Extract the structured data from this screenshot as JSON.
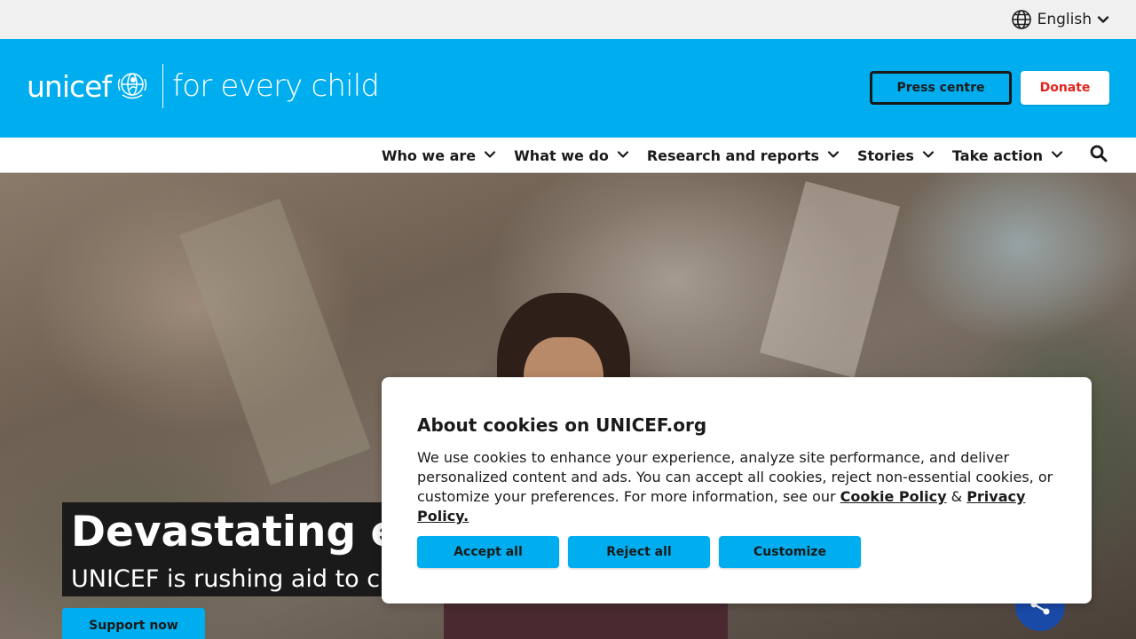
{
  "topbar": {
    "language": "English",
    "language_icon": "globe-icon",
    "language_chevron": "chevron-down-icon"
  },
  "brand": {
    "logo_word": "unicef",
    "tagline": "for every child",
    "press_centre_label": "Press centre",
    "donate_label": "Donate",
    "colors": {
      "brand_blue": "#00aeef",
      "donate_red": "#e2231a",
      "dark": "#1a1a1a"
    }
  },
  "nav": {
    "items": [
      {
        "label": "Who we are"
      },
      {
        "label": "What we do"
      },
      {
        "label": "Research and reports"
      },
      {
        "label": "Stories"
      },
      {
        "label": "Take action"
      }
    ],
    "search_icon": "search-icon"
  },
  "hero": {
    "headline": "Devastating ea",
    "subhead": "UNICEF is rushing aid to ch",
    "cta_label": "Support now",
    "share_icon": "share-icon"
  },
  "cookie": {
    "title": "About cookies on UNICEF.org",
    "text": "We use cookies to enhance your experience, analyze site performance, and deliver personalized content and ads. You can accept all cookies, reject non-essential cookies, or customize your preferences. For more information, see our ",
    "cookie_policy_label": "Cookie Policy",
    "and_text": " & ",
    "privacy_policy_label": "Privacy Policy.",
    "accept_label": "Accept all",
    "reject_label": "Reject all",
    "customize_label": "Customize"
  }
}
